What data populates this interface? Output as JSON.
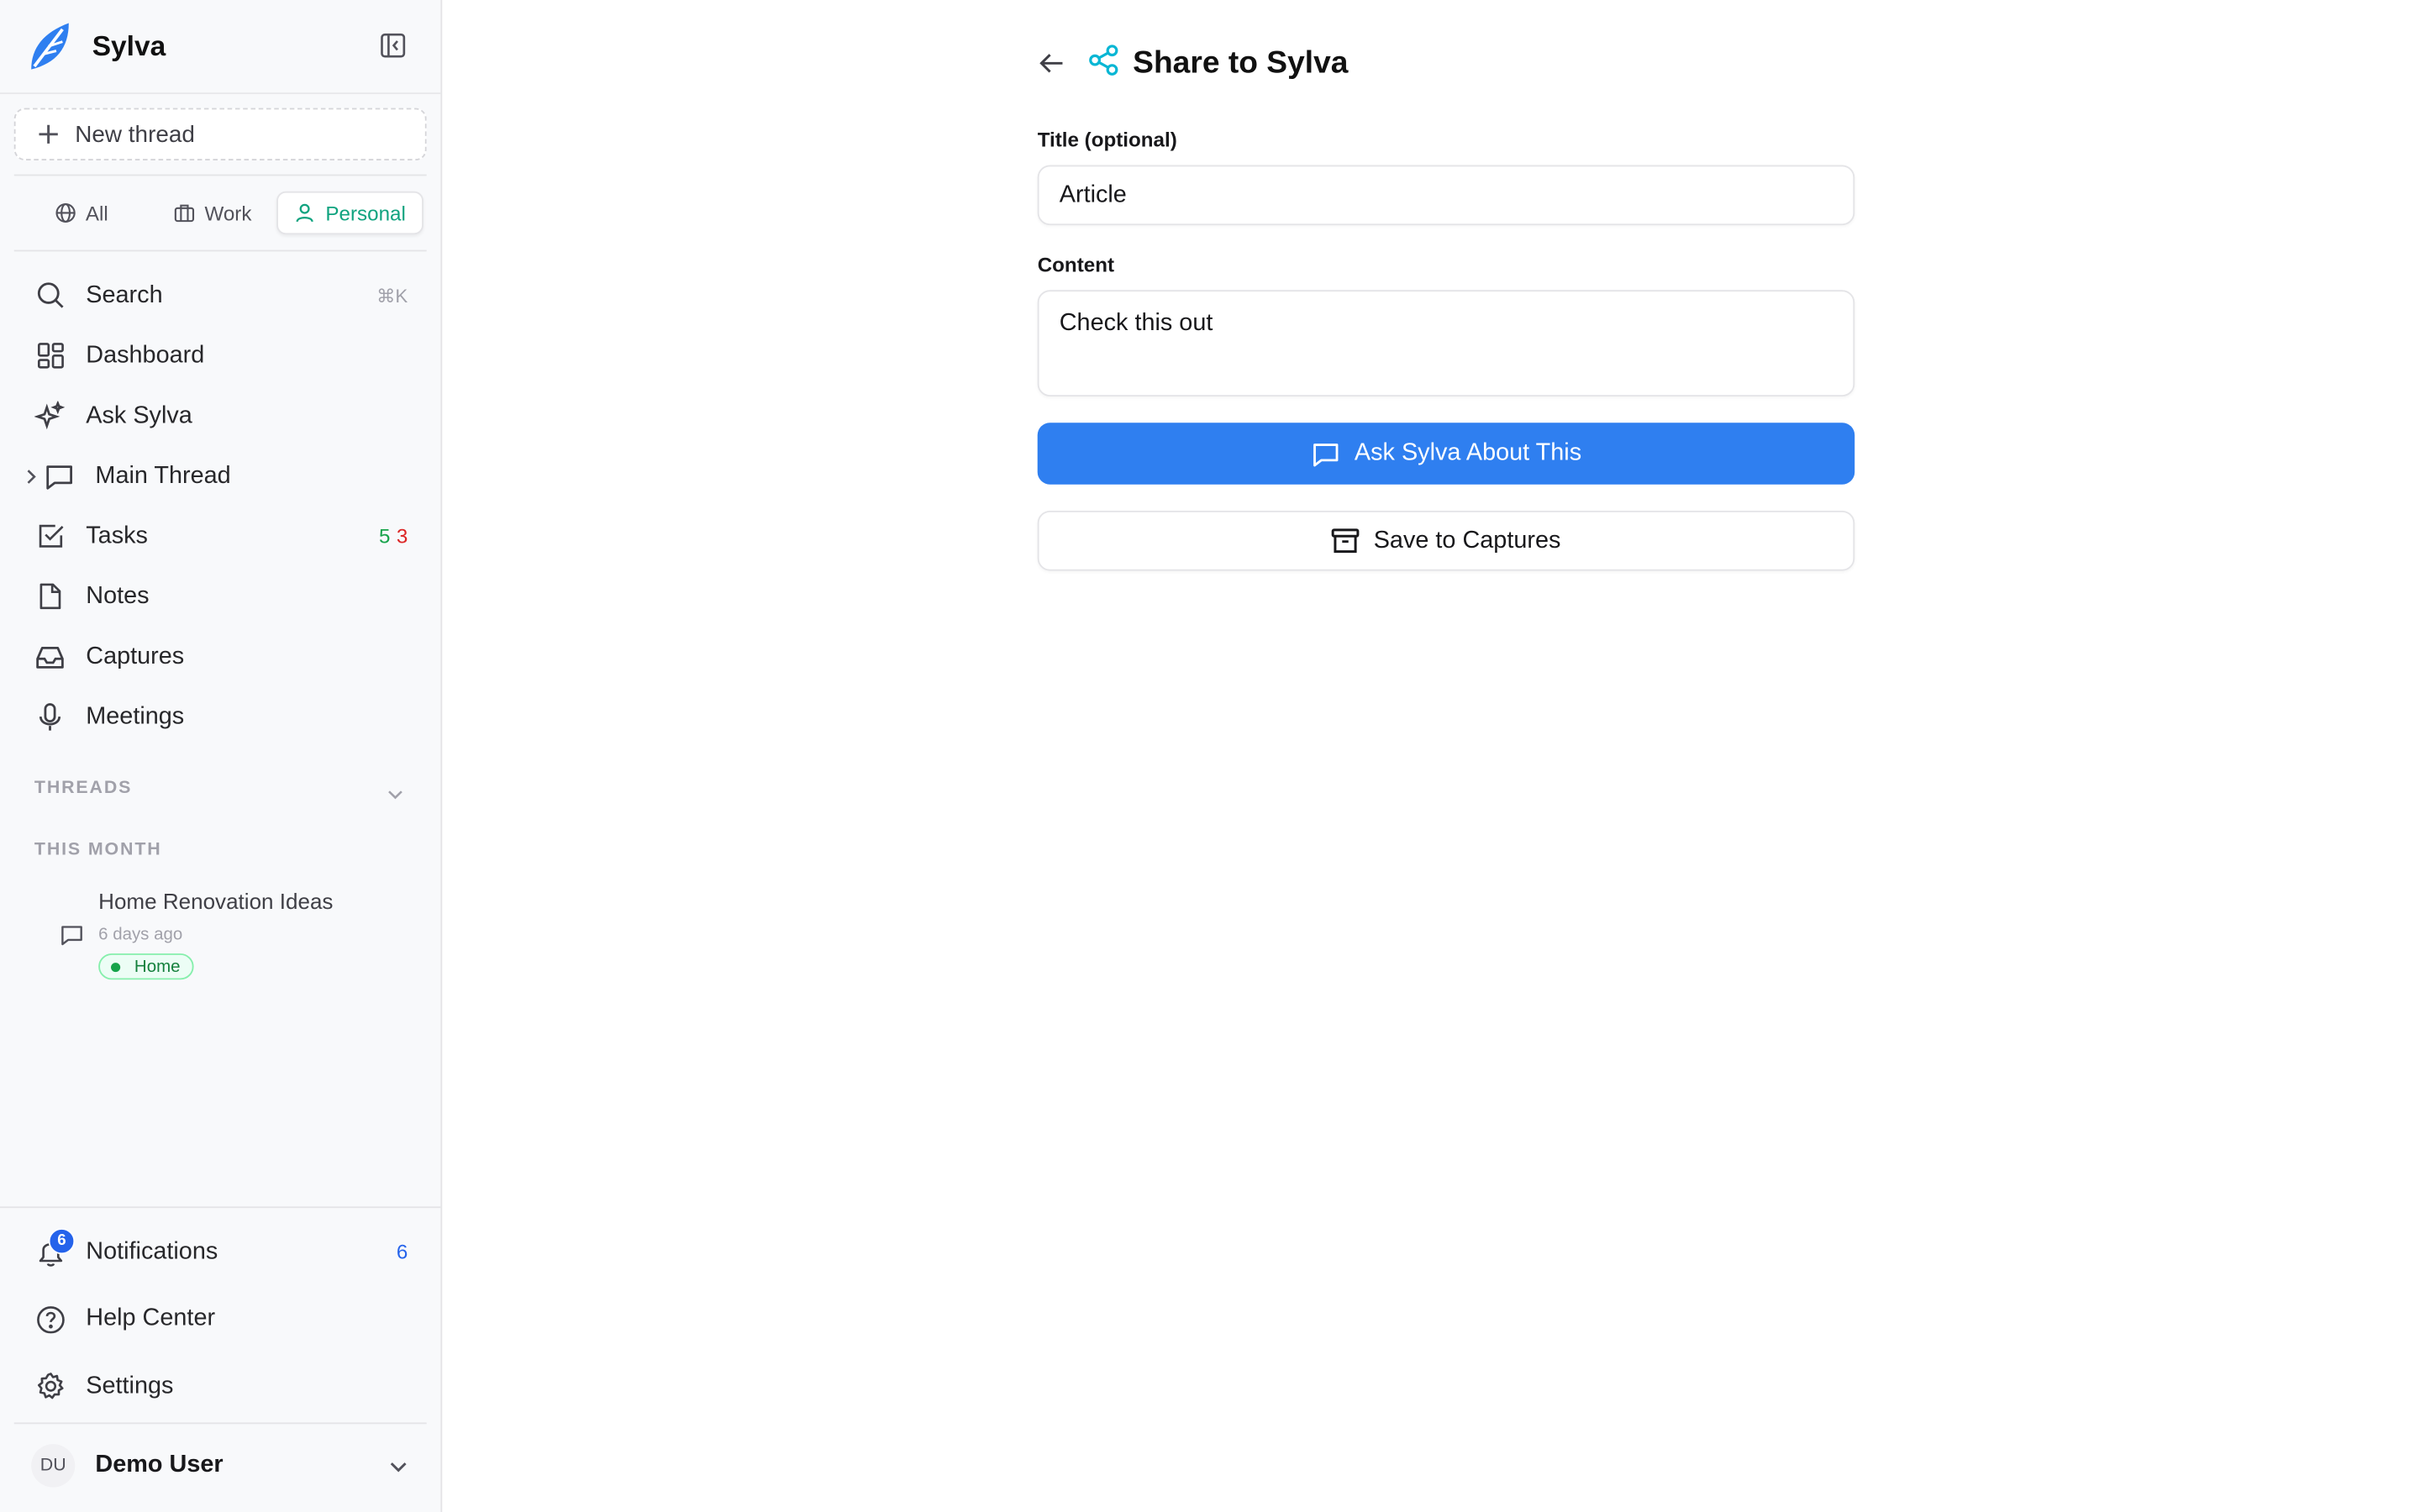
{
  "app": {
    "name": "Sylva"
  },
  "sidebar": {
    "new_thread_label": "New thread",
    "scopes": [
      {
        "label": "All",
        "icon": "globe-icon"
      },
      {
        "label": "Work",
        "icon": "briefcase-icon"
      },
      {
        "label": "Personal",
        "icon": "user-icon",
        "active": true
      }
    ],
    "nav": {
      "search": {
        "label": "Search",
        "shortcut": "⌘K"
      },
      "dashboard": {
        "label": "Dashboard"
      },
      "ask": {
        "label": "Ask Sylva"
      },
      "main_thread": {
        "label": "Main Thread"
      },
      "tasks": {
        "label": "Tasks",
        "count_green": "5",
        "count_red": "3"
      },
      "notes": {
        "label": "Notes"
      },
      "captures": {
        "label": "Captures"
      },
      "meetings": {
        "label": "Meetings"
      }
    },
    "threads_label": "THREADS",
    "this_month_label": "THIS MONTH",
    "thread_items": [
      {
        "title": "Home Renovation Ideas",
        "time": "6 days ago",
        "tag": "Home"
      }
    ],
    "bottom": {
      "notifications": {
        "label": "Notifications",
        "badge": "6",
        "count": "6"
      },
      "help": {
        "label": "Help Center"
      },
      "settings": {
        "label": "Settings"
      }
    },
    "user": {
      "initials": "DU",
      "name": "Demo User"
    }
  },
  "main": {
    "title": "Share to Sylva",
    "title_field": {
      "label": "Title (optional)",
      "value": "Article"
    },
    "content_field": {
      "label": "Content",
      "value": "Check this out"
    },
    "primary_button": "Ask Sylva About This",
    "secondary_button": "Save to Captures"
  },
  "colors": {
    "accent": "#2f7ff0",
    "personal_active": "#10a37f",
    "share_icon": "#06b6d4"
  }
}
